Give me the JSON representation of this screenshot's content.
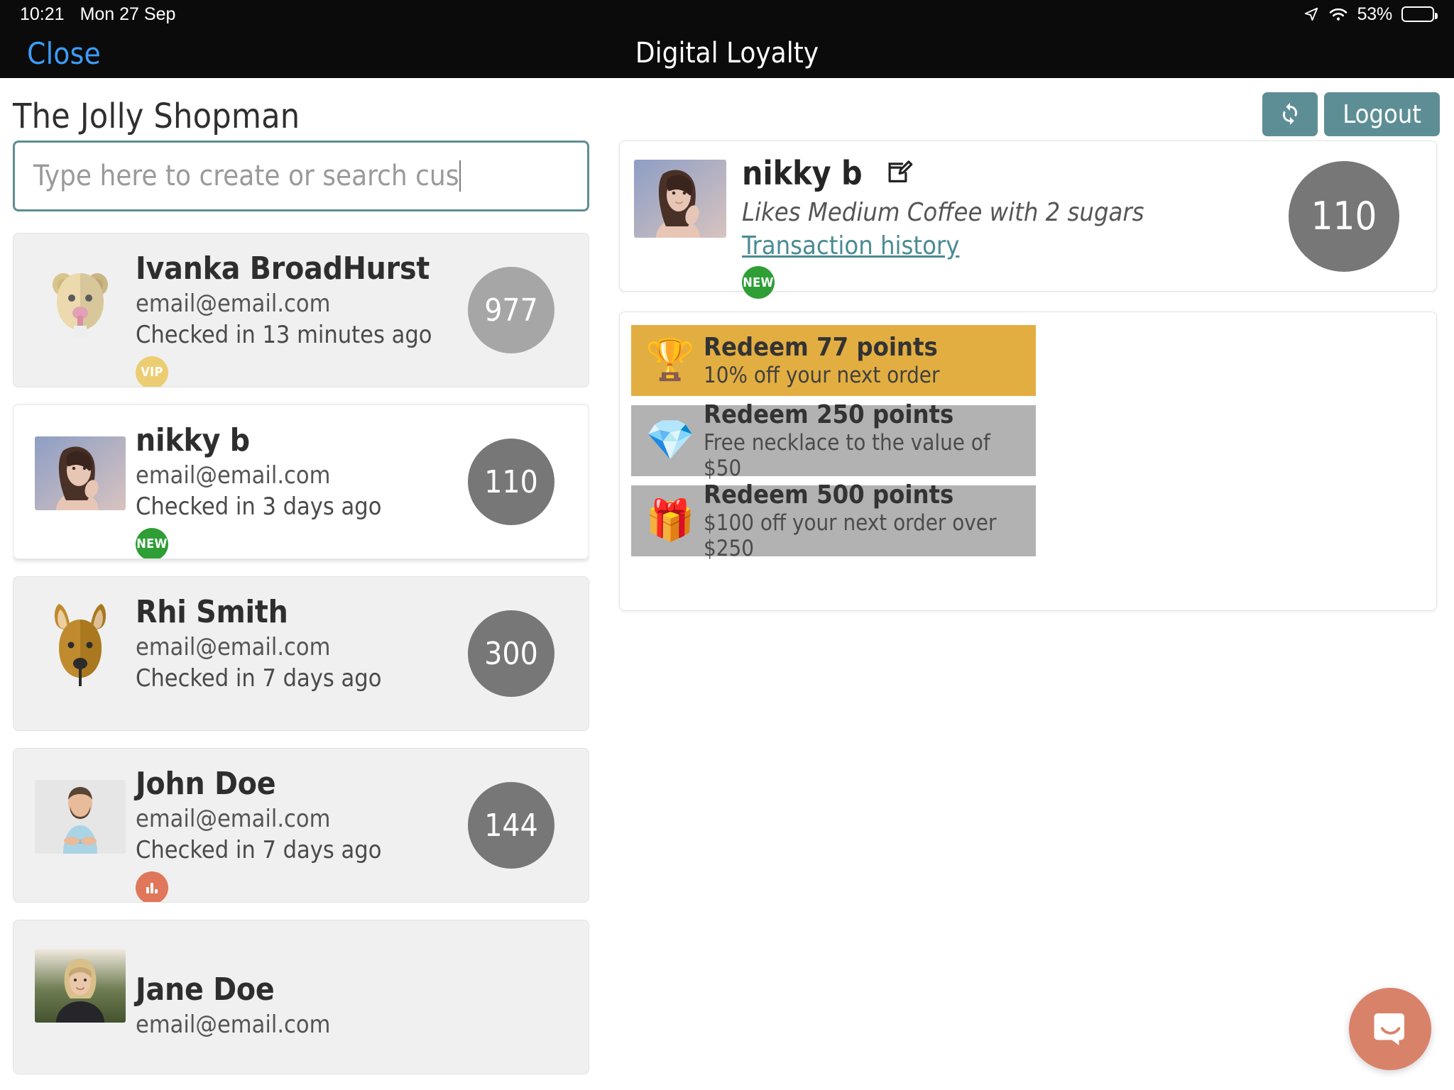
{
  "status_bar": {
    "time": "10:21",
    "date": "Mon 27 Sep",
    "battery_percent": "53%",
    "location_icon": "location-arrow-icon",
    "wifi_icon": "wifi-icon",
    "battery_icon": "battery-icon"
  },
  "nav": {
    "close_label": "Close",
    "title": "Digital Loyalty"
  },
  "header": {
    "shop_name": "The Jolly Shopman",
    "refresh_label": "refresh-icon",
    "logout_label": "Logout"
  },
  "search": {
    "placeholder": "Type here to create or search customers",
    "visible_text": "Type here to create or search cus",
    "value": ""
  },
  "customers": [
    {
      "name": "Ivanka BroadHurst",
      "email": "email@email.com",
      "checkin": "Checked in 13 minutes ago",
      "badge": "VIP",
      "badge_type": "vip",
      "points": "977",
      "points_color": "#a6a6a6",
      "avatar": "beaver-avatar",
      "selected": false
    },
    {
      "name": "nikky b",
      "email": "email@email.com",
      "checkin": "Checked in 3 days ago",
      "badge": "NEW",
      "badge_type": "new",
      "points": "110",
      "points_color": "#777777",
      "avatar": "woman-photo-avatar",
      "selected": true
    },
    {
      "name": "Rhi Smith",
      "email": "email@email.com",
      "checkin": "Checked in 7 days ago",
      "badge": "",
      "badge_type": "none",
      "points": "300",
      "points_color": "#777777",
      "avatar": "kangaroo-avatar",
      "selected": false
    },
    {
      "name": "John Doe",
      "email": "email@email.com",
      "checkin": "Checked in 7 days ago",
      "badge": "",
      "badge_type": "chart",
      "points": "144",
      "points_color": "#777777",
      "avatar": "man-photo-avatar",
      "selected": false
    },
    {
      "name": "Jane Doe",
      "email": "email@email.com",
      "checkin": "",
      "badge": "",
      "badge_type": "none",
      "points": "",
      "points_color": "#777777",
      "avatar": "woman-outdoor-photo-avatar",
      "selected": false
    }
  ],
  "detail": {
    "name": "nikky b",
    "edit_icon": "edit-pencil-icon",
    "note": "Likes Medium Coffee with 2 sugars",
    "history_link": "Transaction history",
    "badge": "NEW",
    "points": "110"
  },
  "rewards": [
    {
      "icon": "trophy-icon",
      "emoji": "🏆",
      "title": "Redeem 77 points",
      "subtitle": "10% off your next order",
      "state": "available",
      "color": "#e3ae41"
    },
    {
      "icon": "gem-icon",
      "emoji": "💎",
      "title": "Redeem 250 points",
      "subtitle": "Free necklace to the value of $50",
      "state": "locked",
      "color": "#b2b2b2"
    },
    {
      "icon": "gift-icon",
      "emoji": "🎁",
      "title": "Redeem 500 points",
      "subtitle": "$100 off your next order over $250",
      "state": "locked",
      "color": "#b2b2b2"
    }
  ],
  "chat": {
    "icon": "chat-bubble-icon",
    "label": "Open messenger"
  },
  "theme": {
    "accent_teal": "#5e8e95",
    "link_blue": "#3c9cfb",
    "gold": "#e3ae41",
    "gray": "#b2b2b2",
    "chat_salmon": "#d9826a",
    "badge_green": "#2e9e35",
    "badge_gold": "#eccd72",
    "badge_orange": "#e0765a"
  }
}
